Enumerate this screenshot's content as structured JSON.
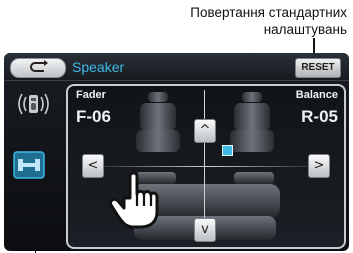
{
  "annotation": {
    "line1": "Повертання стандартних",
    "line2": "налаштувань"
  },
  "header": {
    "title": "Speaker",
    "reset_label": "RESET"
  },
  "fader": {
    "label": "Fader",
    "value": "F-06"
  },
  "balance": {
    "label": "Balance",
    "value": "R-05"
  },
  "icons": {
    "back": "back-arrow-icon",
    "speaker_select": "speaker-select-icon",
    "speaker_layout": "speaker-layout-icon",
    "pointer": "hand-pointer-icon"
  },
  "arrows": {
    "left": "<",
    "right": ">",
    "up": "^",
    "down": "v"
  },
  "colors": {
    "accent": "#3fb8e6"
  }
}
